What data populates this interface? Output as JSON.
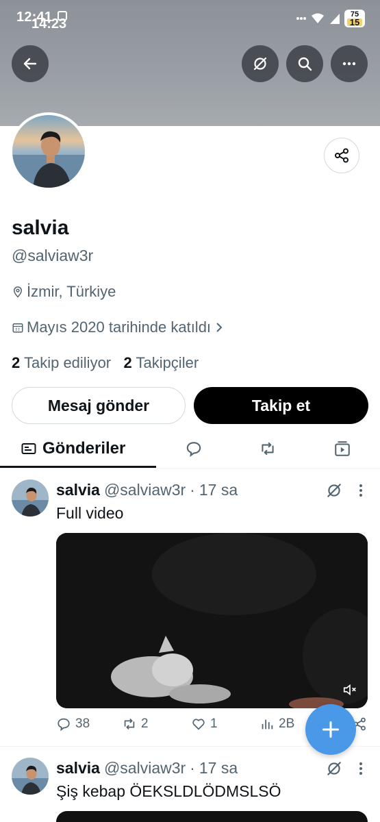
{
  "status_bar": {
    "time": "12:41",
    "time_overlay": "14:23",
    "battery_top": "75",
    "battery_bottom": "15"
  },
  "header": {
    "back_icon": "arrow-left-icon",
    "grok_icon": "grok-icon",
    "search_icon": "search-icon",
    "more_icon": "more-horizontal-icon"
  },
  "profile": {
    "display_name": "salvia",
    "handle": "@salviaw3r",
    "location": "İzmir, Türkiye",
    "joined": "Mayıs 2020 tarihinde katıldı",
    "following_count": "2",
    "following_label": "Takip ediliyor",
    "followers_count": "2",
    "followers_label": "Takipçiler"
  },
  "buttons": {
    "message": "Mesaj gönder",
    "follow": "Takip et"
  },
  "tabs": {
    "active_label": "Gönderiler",
    "items": [
      "posts",
      "replies",
      "reposts",
      "media"
    ]
  },
  "posts": [
    {
      "name": "salvia",
      "handle": "@salviaw3r",
      "dot": "·",
      "time": "17 sa",
      "text": "Full video",
      "replies": "38",
      "reposts": "2",
      "likes": "1",
      "views": "2B"
    },
    {
      "name": "salvia",
      "handle": "@salviaw3r",
      "dot": "·",
      "time": "17 sa",
      "text": "Şiş kebap ÖEKSLDLÖDMSLSÖ"
    }
  ],
  "colors": {
    "accent": "#4a99e9",
    "text_primary": "#0f1419",
    "text_secondary": "#536471",
    "banner": "#9a9fa5"
  }
}
